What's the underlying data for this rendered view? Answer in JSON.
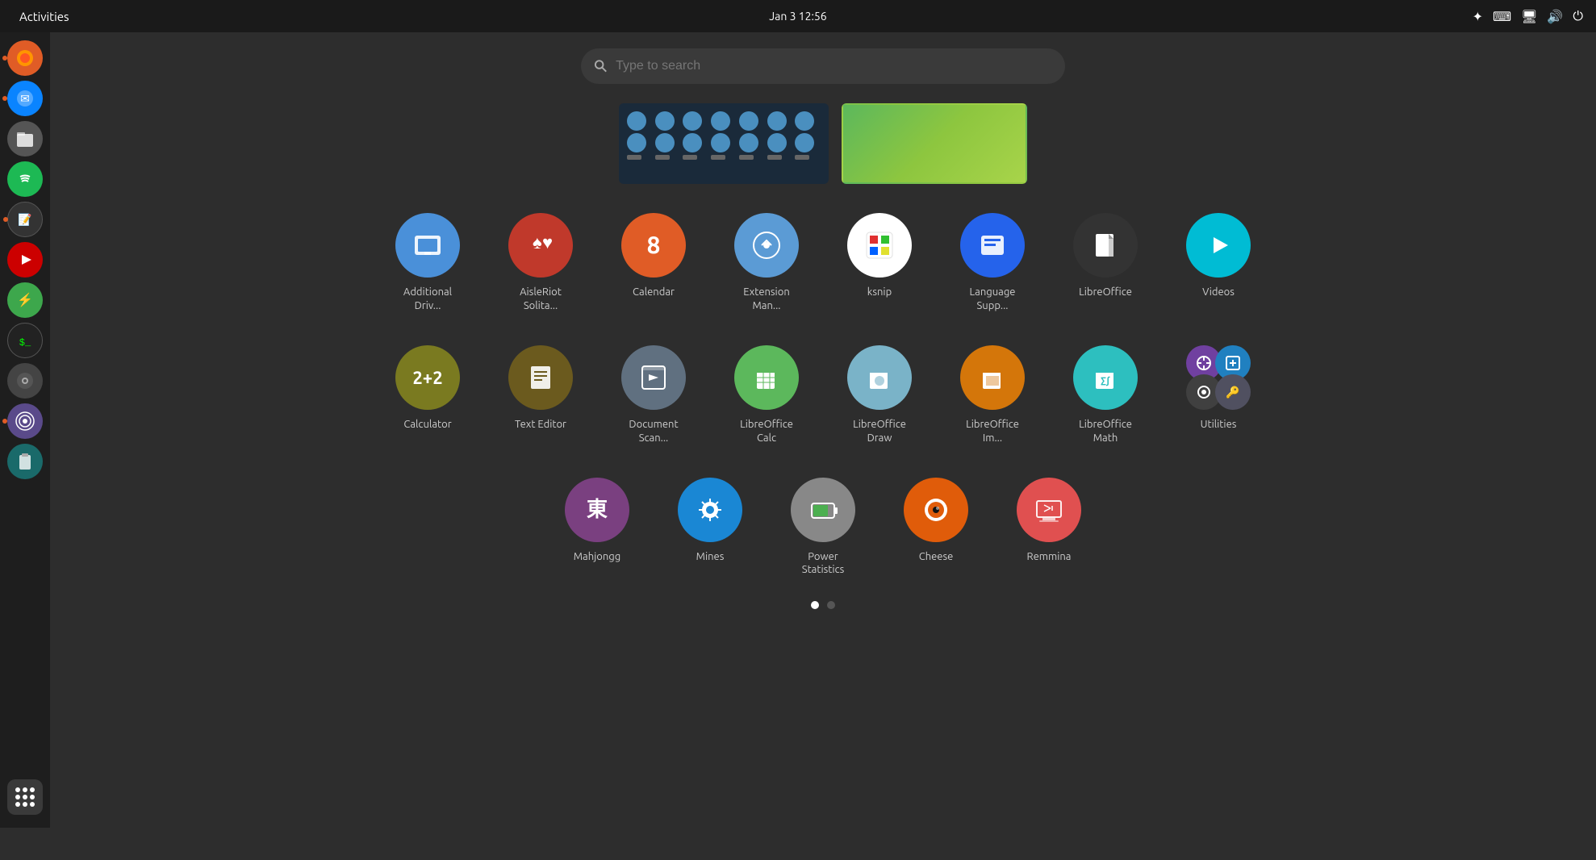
{
  "topbar": {
    "activities_label": "Activities",
    "datetime": "Jan 3  12:56"
  },
  "search": {
    "placeholder": "Type to search"
  },
  "sidebar": {
    "apps": [
      {
        "name": "Firefox",
        "color": "#e05c26",
        "icon": "🦊"
      },
      {
        "name": "Thunderbird",
        "color": "#0a84ff",
        "icon": "✉"
      },
      {
        "name": "Files",
        "color": "#888",
        "icon": "📁"
      },
      {
        "name": "Spotify",
        "color": "#1db954",
        "icon": "♫"
      },
      {
        "name": "Notion",
        "color": "#222",
        "icon": "📝"
      },
      {
        "name": "Video",
        "color": "#c00",
        "icon": "▶"
      },
      {
        "name": "Mixer",
        "color": "#3da74c",
        "icon": "⚡"
      },
      {
        "name": "Terminal",
        "color": "#333",
        "icon": "$"
      },
      {
        "name": "Settings",
        "color": "#555",
        "icon": "⚙"
      },
      {
        "name": "Network",
        "color": "#5a4a8a",
        "icon": "🌐"
      },
      {
        "name": "Clipboard",
        "color": "#1a6a6a",
        "icon": "📋"
      }
    ]
  },
  "apps_row1": [
    {
      "id": "additional-drivers",
      "label": "Additional Driv...",
      "color": "#4a90d9",
      "icon": "gpu"
    },
    {
      "id": "aisleriot-solitaire",
      "label": "AisleRiot Solita...",
      "color": "#c0392b",
      "icon": "cards"
    },
    {
      "id": "calendar",
      "label": "Calendar",
      "color": "#e05c26",
      "icon": "8"
    },
    {
      "id": "extension-manager",
      "label": "Extension Man...",
      "color": "#5b9bd5",
      "icon": "puzzle"
    },
    {
      "id": "ksnip",
      "label": "ksnip",
      "color": "#f5f5f5",
      "icon": "ksnip"
    },
    {
      "id": "language-support",
      "label": "Language Supp...",
      "color": "#2563eb",
      "icon": "lang"
    },
    {
      "id": "libreoffice",
      "label": "LibreOffice",
      "color": "#333",
      "icon": "lo"
    },
    {
      "id": "videos",
      "label": "Videos",
      "color": "#00bcd4",
      "icon": "play"
    }
  ],
  "apps_row2": [
    {
      "id": "calculator",
      "label": "Calculator",
      "color": "#7a7a20",
      "icon": "calc"
    },
    {
      "id": "text-editor",
      "label": "Text Editor",
      "color": "#6b5a1e",
      "icon": "text"
    },
    {
      "id": "document-scanner",
      "label": "Document Scan...",
      "color": "#607080",
      "icon": "scan"
    },
    {
      "id": "libreoffice-calc",
      "label": "LibreOffice Calc",
      "color": "#5cb85c",
      "icon": "calc-lo"
    },
    {
      "id": "libreoffice-draw",
      "label": "LibreOffice Draw",
      "color": "#7ab3c8",
      "icon": "draw-lo"
    },
    {
      "id": "libreoffice-impress",
      "label": "LibreOffice Im...",
      "color": "#d4760a",
      "icon": "impress-lo"
    },
    {
      "id": "libreoffice-math",
      "label": "LibreOffice Math",
      "color": "#2dbfbf",
      "icon": "math-lo"
    },
    {
      "id": "utilities",
      "label": "Utilities",
      "color": "multi",
      "icon": "utilities"
    }
  ],
  "apps_row3": [
    {
      "id": "mahjongg",
      "label": "Mahjongg",
      "color": "#7a4080",
      "icon": "mah"
    },
    {
      "id": "mines",
      "label": "Mines",
      "color": "#1a87d4",
      "icon": "mines"
    },
    {
      "id": "power-statistics",
      "label": "Power Statistics",
      "color": "#888",
      "icon": "battery"
    },
    {
      "id": "cheese",
      "label": "Cheese",
      "color": "#e05c0a",
      "icon": "cheese"
    },
    {
      "id": "remmina",
      "label": "Remmina",
      "color": "#e05050",
      "icon": "remmina"
    }
  ],
  "page_dots": [
    {
      "active": true
    },
    {
      "active": false
    }
  ]
}
